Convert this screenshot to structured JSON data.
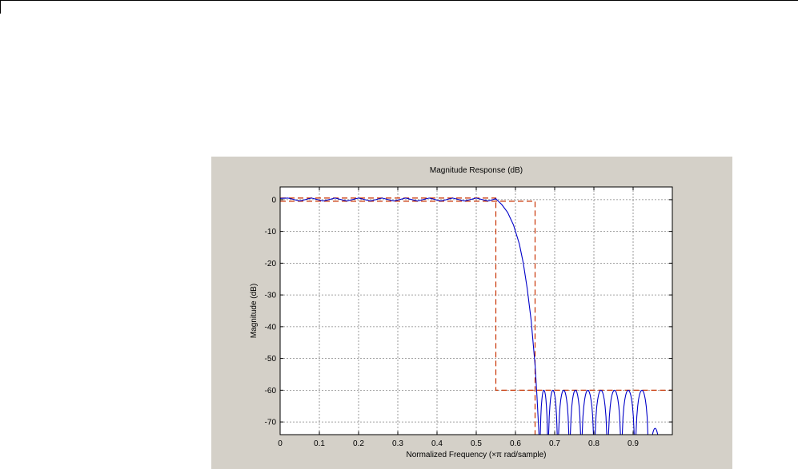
{
  "chart_data": {
    "type": "line",
    "title": "Magnitude Response (dB)",
    "xlabel": "Normalized Frequency (×π rad/sample)",
    "ylabel": "Magnitude (dB)",
    "xlim": [
      0,
      1
    ],
    "ylim": [
      -74,
      4
    ],
    "xticks": [
      0,
      0.1,
      0.2,
      0.3,
      0.4,
      0.5,
      0.6,
      0.7,
      0.8,
      0.9
    ],
    "yticks": [
      0,
      -10,
      -20,
      -30,
      -40,
      -50,
      -60,
      -70
    ],
    "grid": true,
    "colors": {
      "response": "#0000c8",
      "mask": "#c83200",
      "panel": "#d4d0c8"
    },
    "series": [
      {
        "role": "magnitude-response",
        "x": [
          0,
          0.02,
          0.05,
          0.08,
          0.11,
          0.14,
          0.17,
          0.2,
          0.23,
          0.26,
          0.29,
          0.32,
          0.35,
          0.38,
          0.41,
          0.44,
          0.47,
          0.5,
          0.53,
          0.55,
          0.565,
          0.58,
          0.595,
          0.61,
          0.62,
          0.63,
          0.64,
          0.65,
          0.655,
          0.66
        ],
        "y": [
          0.4,
          0.5,
          -0.4,
          0.5,
          -0.4,
          0.5,
          -0.4,
          0.5,
          -0.4,
          0.5,
          -0.4,
          0.5,
          -0.4,
          0.5,
          -0.4,
          0.5,
          -0.4,
          0.5,
          -0.4,
          0.3,
          -1.5,
          -4,
          -8,
          -14,
          -20,
          -28,
          -38,
          -52,
          -62,
          -74
        ]
      }
    ],
    "stopband_lobes": {
      "nulls": [
        0.662,
        0.683,
        0.708,
        0.738,
        0.768,
        0.801,
        0.835,
        0.87,
        0.905,
        0.94,
        0.972
      ],
      "peak": -60,
      "last_peak": -72
    },
    "mask": [
      {
        "x": [
          0,
          0.55,
          0.55,
          0.65,
          0.65,
          1
        ],
        "y": [
          0.5,
          0.5,
          -60,
          -60,
          -60,
          -60
        ]
      },
      {
        "x": [
          0,
          0.65,
          0.65
        ],
        "y": [
          -0.5,
          -0.5,
          -74
        ]
      }
    ]
  }
}
